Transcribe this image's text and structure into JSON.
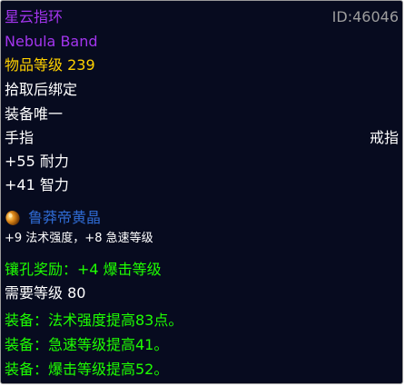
{
  "item": {
    "name": "星云指环",
    "id_label": "ID:46046",
    "english_name": "Nebula Band",
    "item_level": "物品等级 239",
    "bind": "拾取后绑定",
    "unique": "装备唯一",
    "slot": "手指",
    "type": "戒指",
    "stats": [
      "+55 耐力",
      "+41 智力"
    ],
    "gem": {
      "icon": "gem-icon",
      "name": "鲁莽帝黄晶",
      "bonus": "+9 法术强度，+8 急速等级"
    },
    "socket_bonus": "镶孔奖励：+4 爆击等级",
    "required_level": "需要等级 80",
    "equip_effects": [
      "装备：法术强度提高83点。",
      "装备：急速等级提高41。",
      "装备：爆击等级提高52。"
    ]
  },
  "colors": {
    "epic": "#a335ee",
    "gold": "#ffd100",
    "green": "#1eff00",
    "gray": "#9d9d9d",
    "gem_blue": "#2f6bd4",
    "background": "#070b1f"
  }
}
